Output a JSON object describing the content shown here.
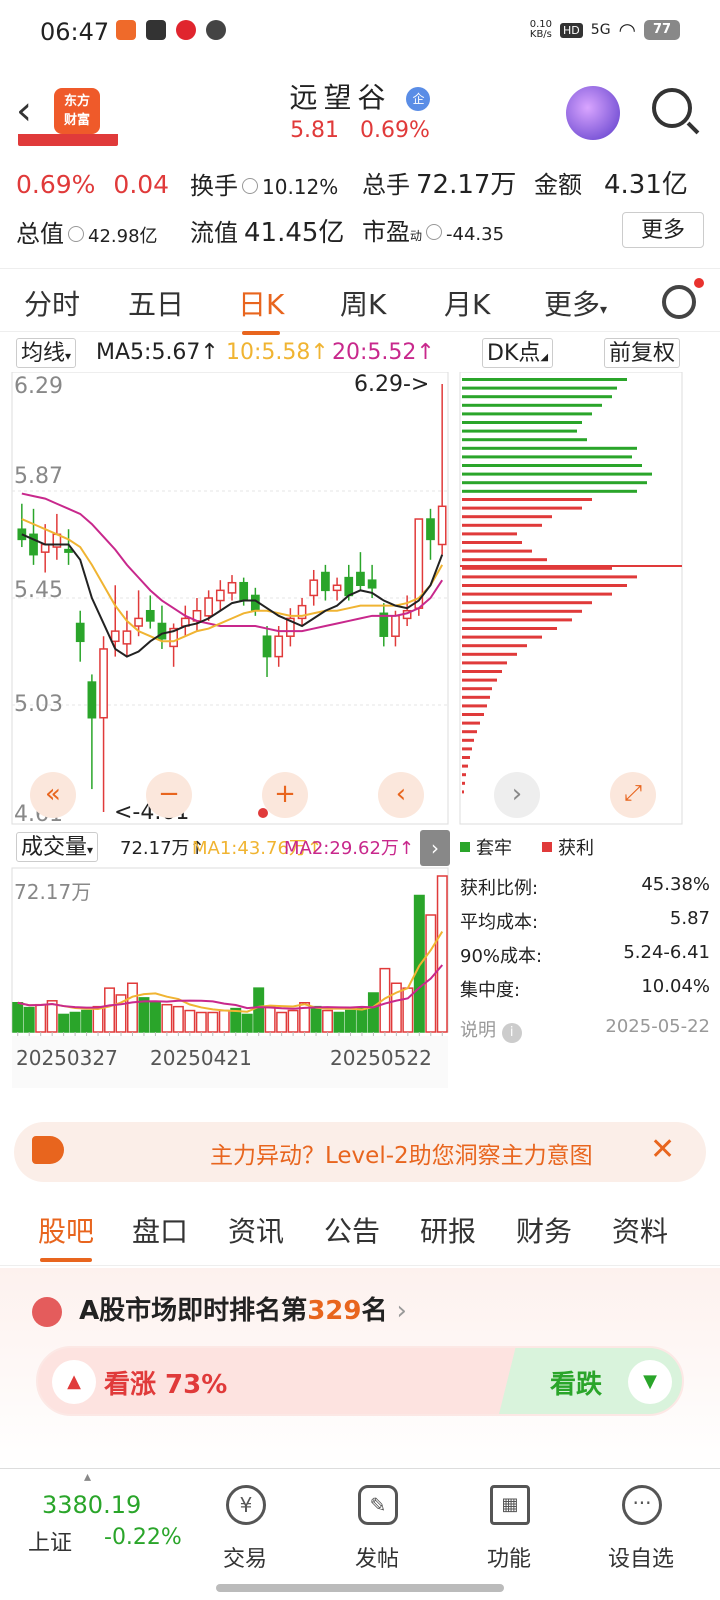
{
  "status_bar": {
    "time": "06:47",
    "net_speed": "0.10\nKB/s",
    "hd": "HD",
    "signal": "5G",
    "battery": "77"
  },
  "header": {
    "logo_text": "东方\n财富",
    "stock_name": "远望谷",
    "badge": "企",
    "price_line": "5.81   0.69%"
  },
  "quote": {
    "change_pct": "0.69%",
    "change_amt": "0.04",
    "turnover_label": "换手",
    "turnover_value": "10.12%",
    "volume_label": "总手",
    "volume_value": "72.17万",
    "amount_label": "金额",
    "amount_value": "4.31亿",
    "market_cap_label": "总值",
    "market_cap_value": "42.98亿",
    "float_cap_label": "流值",
    "float_cap_value": "41.45亿",
    "pe_label": "市盈",
    "pe_sup": "动",
    "pe_value": "-44.35",
    "more_button": "更多"
  },
  "kline_tabs": [
    "分时",
    "五日",
    "日K",
    "周K",
    "月K",
    "更多"
  ],
  "ma_row": {
    "selector": "均线",
    "ma5": "MA5:5.67↑",
    "ma10": "10:5.58↑",
    "ma20": "20:5.52↑",
    "dk": "DK点",
    "adjust": "前复权"
  },
  "chart_data": {
    "type": "candlestick",
    "price_ticks": [
      "6.29",
      "5.87",
      "5.45",
      "5.03",
      "4.61"
    ],
    "ylim": [
      4.61,
      6.29
    ],
    "high_label": "6.29->",
    "low_label": "<-4.61",
    "volume_selector": "成交量",
    "vol_value": "72.17万↑",
    "vol_ma1": "MA1:43.76万↑",
    "vol_ma2": "MA2:29.62万↑",
    "vol_max_label": "72.17万",
    "dates": [
      "20250327",
      "20250421",
      "20250522"
    ],
    "colors": {
      "up": "#e03a3a",
      "down": "#2aa52a",
      "ma5": "#222222",
      "ma10": "#f0b432",
      "ma20": "#c8288c"
    },
    "candles": [
      {
        "o": 5.72,
        "h": 5.82,
        "l": 5.65,
        "c": 5.68
      },
      {
        "o": 5.7,
        "h": 5.8,
        "l": 5.58,
        "c": 5.62
      },
      {
        "o": 5.63,
        "h": 5.74,
        "l": 5.55,
        "c": 5.66
      },
      {
        "o": 5.65,
        "h": 5.78,
        "l": 5.6,
        "c": 5.7
      },
      {
        "o": 5.64,
        "h": 5.72,
        "l": 5.58,
        "c": 5.63
      },
      {
        "o": 5.35,
        "h": 5.4,
        "l": 5.2,
        "c": 5.28
      },
      {
        "o": 5.12,
        "h": 5.15,
        "l": 4.7,
        "c": 4.98
      },
      {
        "o": 4.98,
        "h": 5.3,
        "l": 4.61,
        "c": 5.25
      },
      {
        "o": 5.28,
        "h": 5.5,
        "l": 5.22,
        "c": 5.32
      },
      {
        "o": 5.27,
        "h": 5.4,
        "l": 5.22,
        "c": 5.32
      },
      {
        "o": 5.34,
        "h": 5.48,
        "l": 5.3,
        "c": 5.37
      },
      {
        "o": 5.4,
        "h": 5.46,
        "l": 5.33,
        "c": 5.36
      },
      {
        "o": 5.35,
        "h": 5.42,
        "l": 5.25,
        "c": 5.29
      },
      {
        "o": 5.26,
        "h": 5.35,
        "l": 5.18,
        "c": 5.33
      },
      {
        "o": 5.34,
        "h": 5.42,
        "l": 5.3,
        "c": 5.37
      },
      {
        "o": 5.36,
        "h": 5.45,
        "l": 5.32,
        "c": 5.4
      },
      {
        "o": 5.38,
        "h": 5.48,
        "l": 5.36,
        "c": 5.45
      },
      {
        "o": 5.44,
        "h": 5.52,
        "l": 5.4,
        "c": 5.48
      },
      {
        "o": 5.47,
        "h": 5.54,
        "l": 5.44,
        "c": 5.51
      },
      {
        "o": 5.51,
        "h": 5.53,
        "l": 5.42,
        "c": 5.44
      },
      {
        "o": 5.46,
        "h": 5.49,
        "l": 5.38,
        "c": 5.4
      },
      {
        "o": 5.3,
        "h": 5.34,
        "l": 5.14,
        "c": 5.22
      },
      {
        "o": 5.22,
        "h": 5.34,
        "l": 5.18,
        "c": 5.3
      },
      {
        "o": 5.3,
        "h": 5.41,
        "l": 5.26,
        "c": 5.37
      },
      {
        "o": 5.37,
        "h": 5.45,
        "l": 5.34,
        "c": 5.42
      },
      {
        "o": 5.46,
        "h": 5.56,
        "l": 5.42,
        "c": 5.52
      },
      {
        "o": 5.55,
        "h": 5.58,
        "l": 5.44,
        "c": 5.48
      },
      {
        "o": 5.48,
        "h": 5.53,
        "l": 5.44,
        "c": 5.5
      },
      {
        "o": 5.53,
        "h": 5.58,
        "l": 5.44,
        "c": 5.46
      },
      {
        "o": 5.55,
        "h": 5.63,
        "l": 5.48,
        "c": 5.5
      },
      {
        "o": 5.52,
        "h": 5.58,
        "l": 5.45,
        "c": 5.49
      },
      {
        "o": 5.39,
        "h": 5.43,
        "l": 5.26,
        "c": 5.3
      },
      {
        "o": 5.3,
        "h": 5.4,
        "l": 5.26,
        "c": 5.38
      },
      {
        "o": 5.37,
        "h": 5.46,
        "l": 5.34,
        "c": 5.4
      },
      {
        "o": 5.41,
        "h": 5.76,
        "l": 5.38,
        "c": 5.76
      },
      {
        "o": 5.76,
        "h": 5.8,
        "l": 5.6,
        "c": 5.68
      },
      {
        "o": 5.66,
        "h": 6.29,
        "l": 5.62,
        "c": 5.81
      }
    ],
    "ma5": [
      5.7,
      5.68,
      5.66,
      5.66,
      5.66,
      5.6,
      5.45,
      5.35,
      5.25,
      5.22,
      5.24,
      5.28,
      5.31,
      5.32,
      5.34,
      5.35,
      5.37,
      5.4,
      5.43,
      5.44,
      5.44,
      5.41,
      5.38,
      5.36,
      5.34,
      5.37,
      5.4,
      5.42,
      5.46,
      5.48,
      5.47,
      5.44,
      5.42,
      5.41,
      5.44,
      5.5,
      5.62
    ],
    "ma10": [
      5.76,
      5.74,
      5.72,
      5.7,
      5.68,
      5.65,
      5.58,
      5.5,
      5.42,
      5.36,
      5.32,
      5.3,
      5.28,
      5.28,
      5.3,
      5.32,
      5.33,
      5.35,
      5.37,
      5.39,
      5.4,
      5.4,
      5.39,
      5.38,
      5.38,
      5.39,
      5.4,
      5.4,
      5.41,
      5.42,
      5.42,
      5.42,
      5.42,
      5.43,
      5.45,
      5.5,
      5.58
    ],
    "ma20": [
      5.86,
      5.85,
      5.84,
      5.82,
      5.8,
      5.78,
      5.74,
      5.69,
      5.64,
      5.58,
      5.53,
      5.48,
      5.44,
      5.41,
      5.38,
      5.36,
      5.35,
      5.34,
      5.34,
      5.34,
      5.34,
      5.33,
      5.32,
      5.32,
      5.32,
      5.33,
      5.34,
      5.35,
      5.36,
      5.37,
      5.38,
      5.38,
      5.38,
      5.39,
      5.41,
      5.45,
      5.52
    ],
    "volumes": [
      30,
      25,
      28,
      32,
      18,
      20,
      22,
      26,
      45,
      38,
      50,
      35,
      30,
      28,
      26,
      22,
      20,
      20,
      22,
      24,
      18,
      45,
      26,
      20,
      22,
      30,
      26,
      22,
      20,
      22,
      25,
      40,
      65,
      50,
      45,
      140,
      120,
      160
    ],
    "chip_profile": {
      "green_widths": [
        165,
        155,
        150,
        140,
        130,
        120,
        115,
        125,
        175,
        170,
        180,
        190,
        185,
        175
      ],
      "red_widths": [
        130,
        120,
        90,
        80,
        55,
        60,
        70,
        85,
        150,
        175,
        165,
        150,
        130,
        120,
        110,
        95,
        80,
        65,
        55,
        45,
        40,
        35,
        30,
        28,
        25,
        22,
        18,
        15,
        12,
        10,
        8,
        6,
        4,
        3,
        2
      ]
    }
  },
  "chip_stats": {
    "legend_trapped": "套牢",
    "legend_profit": "获利",
    "rows": [
      {
        "label": "获利比例:",
        "value": "45.38%"
      },
      {
        "label": "平均成本:",
        "value": "5.87"
      },
      {
        "label": "90%成本:",
        "value": "5.24-6.41"
      },
      {
        "label": "集中度:",
        "value": "10.04%"
      }
    ],
    "note_label": "说明",
    "date": "2025-05-22"
  },
  "banner": {
    "text": "主力异动？Level-2助您洞察主力意图"
  },
  "bottom_tabs": [
    "股吧",
    "盘口",
    "资讯",
    "公告",
    "研报",
    "财务",
    "资料"
  ],
  "ranking": {
    "prefix": "A股市场即时排名第",
    "rank": "329",
    "suffix": "名",
    "bullish": "看涨 73%",
    "bearish": "看跌"
  },
  "nav": {
    "index_value": "3380.19",
    "index_name": "上证",
    "index_change": "-0.22%",
    "items": [
      "交易",
      "发帖",
      "功能",
      "设自选"
    ]
  }
}
